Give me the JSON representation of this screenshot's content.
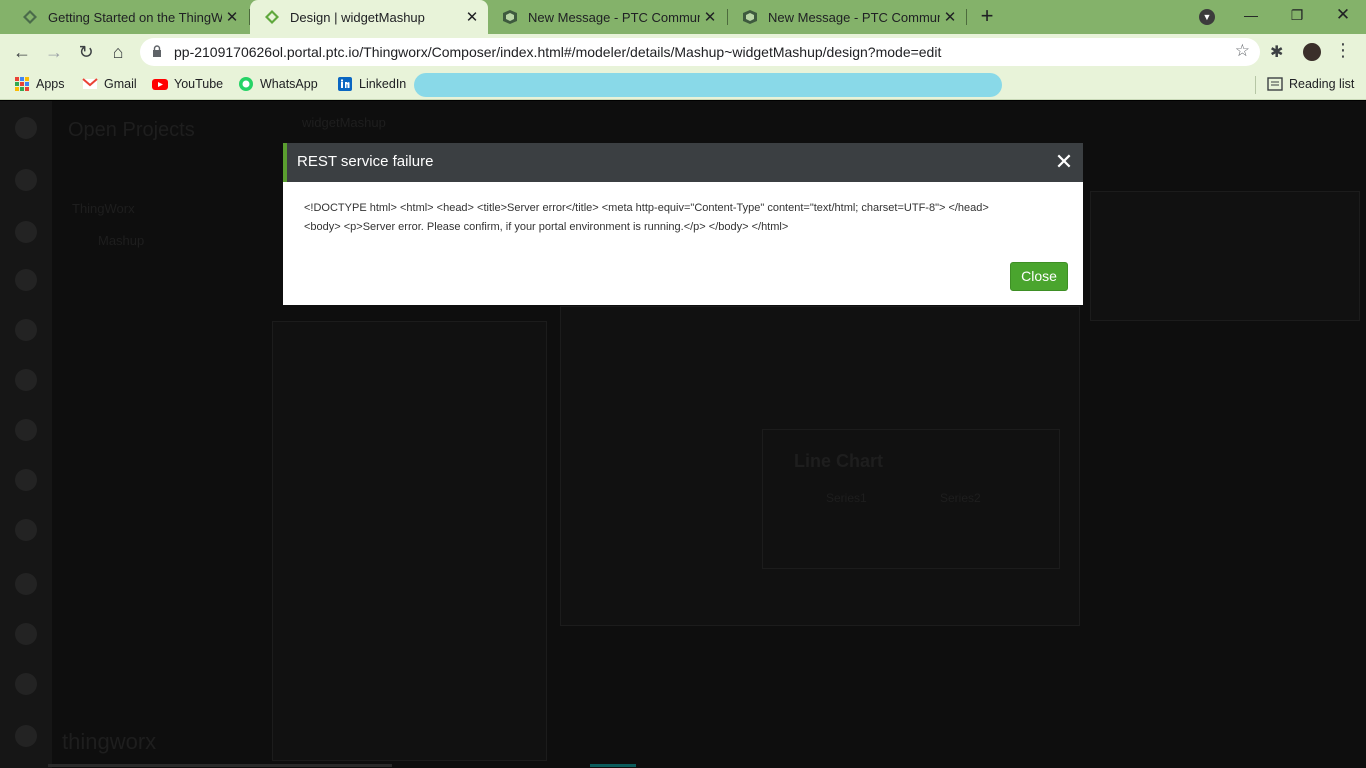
{
  "browser": {
    "tabs": [
      {
        "title": "Getting Started on the ThingWor",
        "active": false
      },
      {
        "title": "Design | widgetMashup",
        "active": true
      },
      {
        "title": "New Message - PTC Community",
        "active": false
      },
      {
        "title": "New Message - PTC Community",
        "active": false
      }
    ],
    "url": "pp-2109170626ol.portal.ptc.io/Thingworx/Composer/index.html#/modeler/details/Mashup~widgetMashup/design?mode=edit",
    "bookmarks": [
      "Apps",
      "Gmail",
      "YouTube",
      "WhatsApp",
      "LinkedIn"
    ],
    "reading_list": "Reading list"
  },
  "background": {
    "open_projects": "Open Projects",
    "tree_items": [
      "ThingWorx",
      "Mashup"
    ],
    "entity": "widgetMashup",
    "chart_title": "Line Chart",
    "legend": [
      "Series1",
      "Series2"
    ],
    "brand": "thingworx"
  },
  "modal": {
    "title": "REST service failure",
    "message_line1": "<!DOCTYPE html> <html> <head> <title>Server error</title> <meta http-equiv=\"Content-Type\" content=\"text/html; charset=UTF-8\"> </head>",
    "message_line2": "<body> <p>Server error. Please confirm, if your portal environment is running.</p> </body> </html>",
    "close_label": "Close"
  },
  "colors": {
    "tabstrip": "#84b26a",
    "toolbar": "#e8f3d9",
    "modal_header": "#3b3f42",
    "accent_green": "#4aa52e"
  }
}
